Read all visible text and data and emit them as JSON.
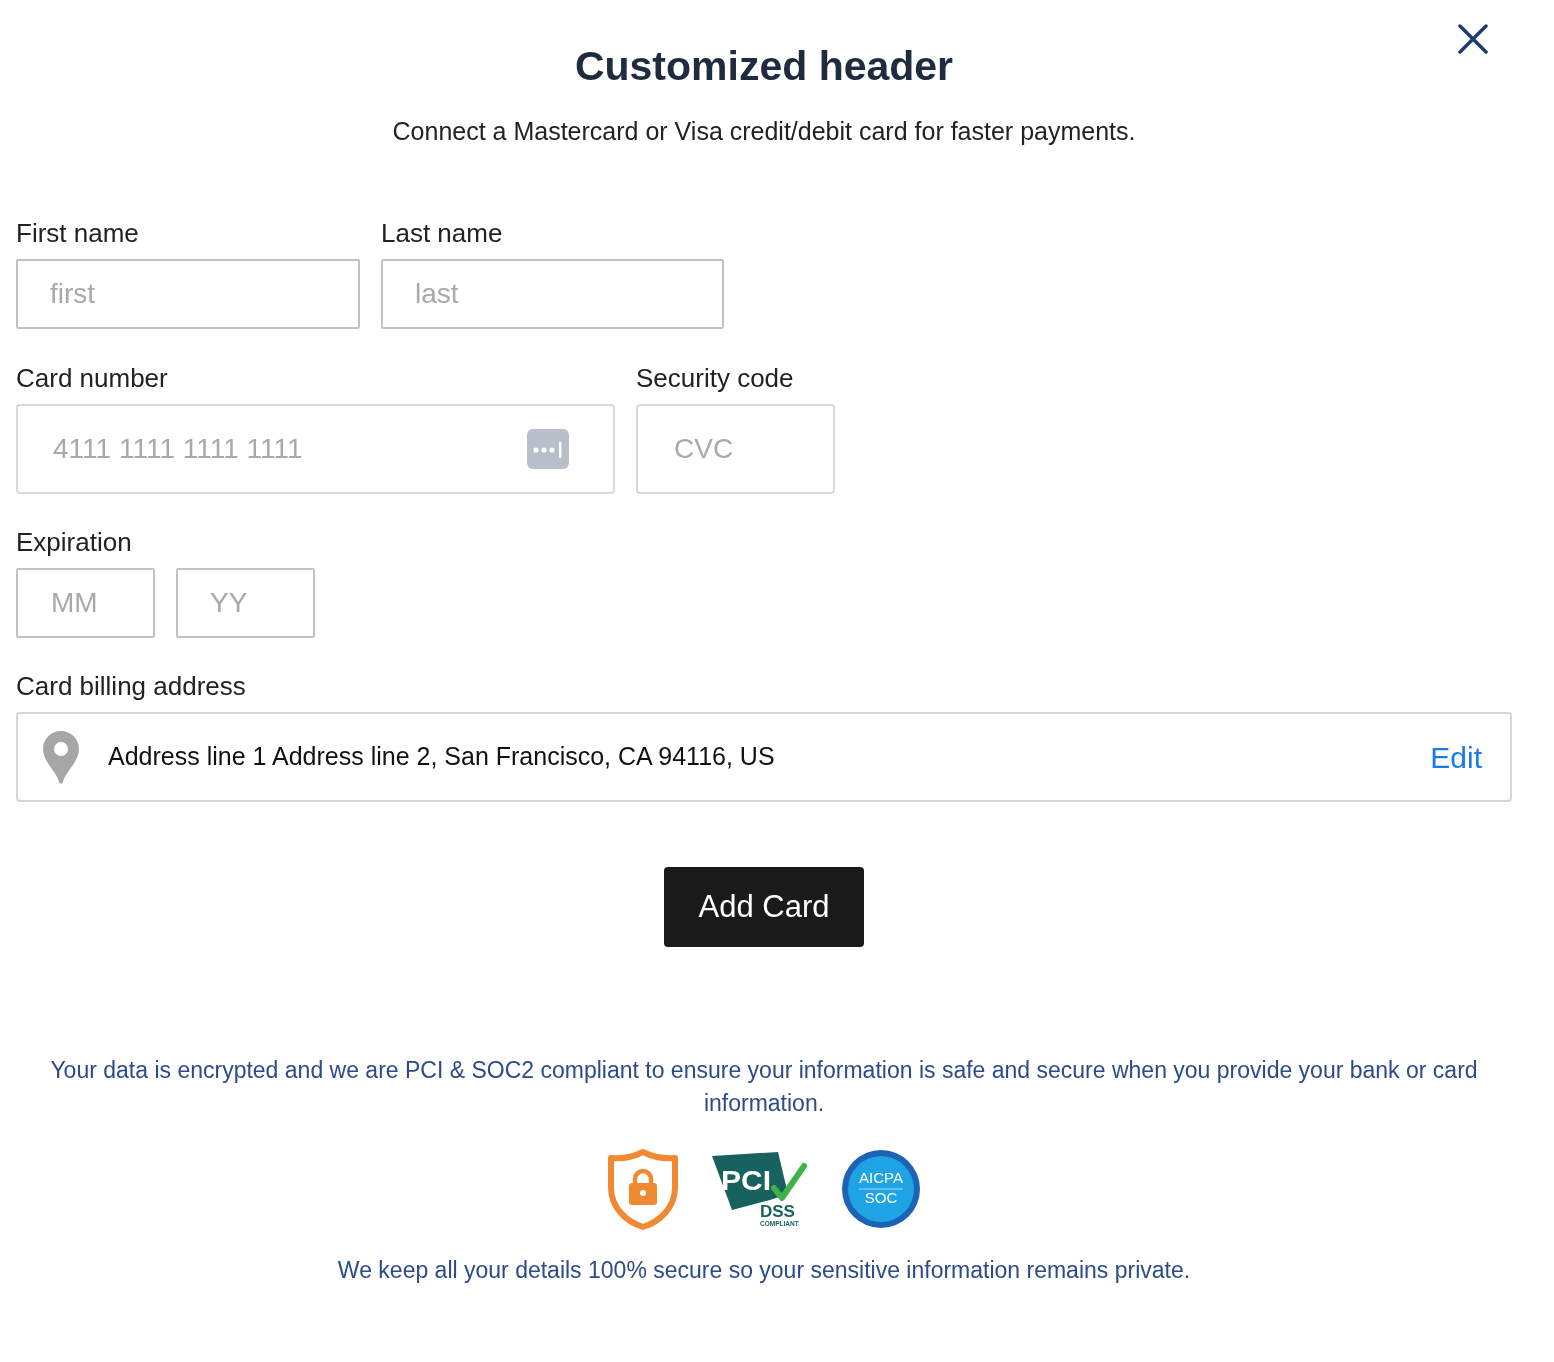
{
  "header": {
    "title": "Customized header",
    "subtitle": "Connect a Mastercard or Visa credit/debit card for faster payments."
  },
  "first_name": {
    "label": "First name",
    "placeholder": "first"
  },
  "last_name": {
    "label": "Last name",
    "placeholder": "last"
  },
  "card_number": {
    "label": "Card number",
    "placeholder": "4111 1111 1111 1111"
  },
  "security_code": {
    "label": "Security code",
    "placeholder": "CVC"
  },
  "expiration": {
    "label": "Expiration",
    "month": {
      "placeholder": "MM"
    },
    "year": {
      "placeholder": "YY"
    }
  },
  "billing_address": {
    "label": "Card billing address",
    "value": "Address line 1 Address line 2, San Francisco, CA 94116, US",
    "edit": "Edit"
  },
  "submit": "Add Card",
  "security_note": "Your data is encrypted and we are PCI & SOC2 compliant to ensure your information is safe and secure when you provide your bank or card information.",
  "badges": [
    {
      "kind": "shield"
    },
    {
      "kind": "pci",
      "texts": [
        "PCI",
        "DSS",
        "COMPLIANT"
      ]
    },
    {
      "kind": "aicpa",
      "texts": [
        "AICPA",
        "SOC"
      ]
    }
  ],
  "privacy_note": "We keep all your details 100% secure so your sensitive information remains private."
}
